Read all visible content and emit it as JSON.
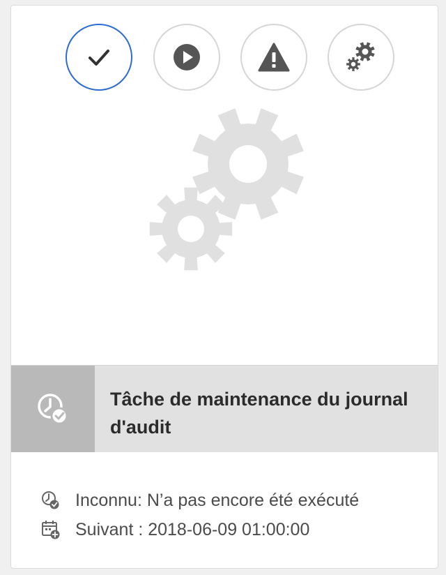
{
  "task": {
    "title": "Tâche de maintenance du journal d'audit"
  },
  "toolbar": {
    "buttons": [
      {
        "name": "check-button",
        "icon": "checkmark-icon",
        "selected": true
      },
      {
        "name": "run-button",
        "icon": "play-icon",
        "selected": false
      },
      {
        "name": "warning-button",
        "icon": "warning-icon",
        "selected": false
      },
      {
        "name": "settings-button",
        "icon": "gears-icon",
        "selected": false
      }
    ]
  },
  "status": {
    "last_run": "Inconnu: N’a pas encore été exécuté",
    "next_run": "Suivant : 2018-06-09 01:00:00"
  },
  "colors": {
    "selected_border": "#2c6cd1",
    "icon_gray": "#555555",
    "hero_gear": "#e0e0e0",
    "title_icon_box": "#b9b9b9",
    "title_bar": "#e1e1e1"
  }
}
